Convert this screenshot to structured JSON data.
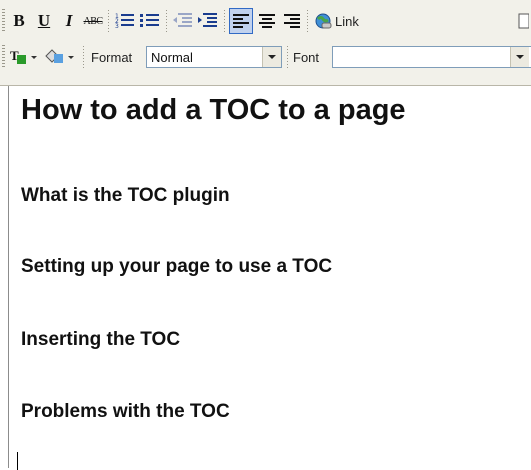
{
  "toolbar": {
    "row1": {
      "bold_glyph": "B",
      "underline_glyph": "U",
      "italic_glyph": "I",
      "strike_glyph": "ABC",
      "link_label": "Link"
    },
    "row2": {
      "format_label": "Format",
      "format_value": "Normal",
      "font_label": "Font",
      "font_value": ""
    },
    "active_color": "#316ac5"
  },
  "document": {
    "heading1": "How to add a TOC to a page",
    "headings": [
      "What is the TOC plugin",
      "Setting up your page to use a TOC",
      "Inserting the TOC",
      "Problems with the TOC"
    ]
  }
}
